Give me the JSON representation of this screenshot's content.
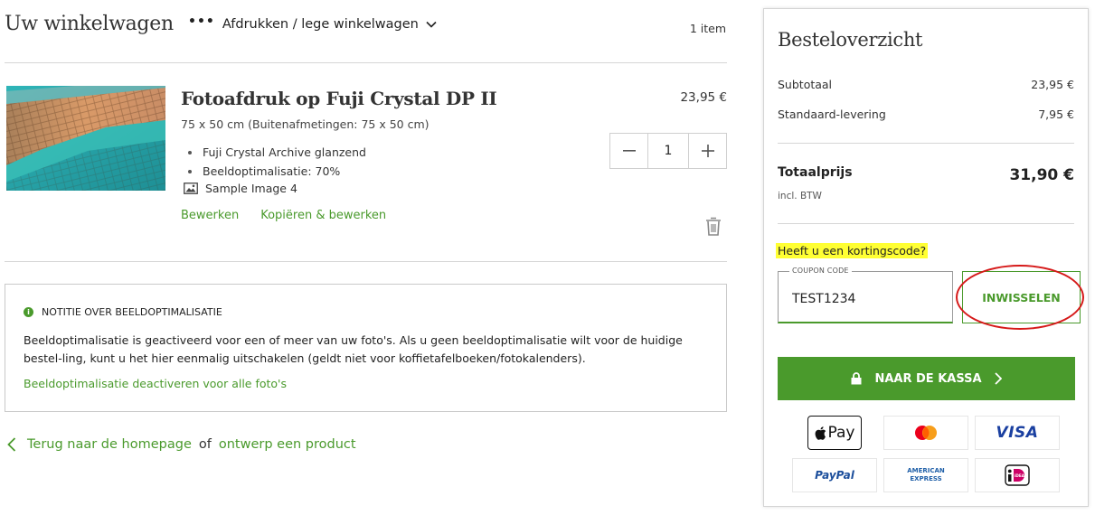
{
  "header": {
    "title": "Uw winkelwagen",
    "menu_label": "Afdrukken / lege winkelwagen",
    "item_count": "1 item"
  },
  "product": {
    "title": "Fotoafdruk op Fuji Crystal DP II",
    "size": "75 x 50 cm (Buitenafmetingen: 75 x 50 cm)",
    "options": [
      "Fuji Crystal Archive glanzend",
      "Beeldoptimalisatie: 70%"
    ],
    "image_name": "Sample Image 4",
    "edit_label": "Bewerken",
    "copy_edit_label": "Kopiëren & bewerken",
    "price": "23,95 €",
    "quantity": "1"
  },
  "notice": {
    "heading": "NOTITIE OVER BEELDOPTIMALISATIE",
    "text": "Beeldoptimalisatie is geactiveerd voor een of meer van uw foto's. Als u geen beeldoptimalisatie wilt voor de huidige bestel-ling, kunt u het hier eenmalig uitschakelen (geldt niet voor koffietafelboeken/fotokalenders).",
    "link": "Beeldoptimalisatie deactiveren voor alle foto's"
  },
  "footer_nav": {
    "back_link": "Terug naar de homepage",
    "separator": "of",
    "design_link": "ontwerp een product"
  },
  "summary": {
    "title": "Besteloverzicht",
    "subtotal_label": "Subtotaal",
    "subtotal_value": "23,95 €",
    "shipping_label": "Standaard-levering",
    "shipping_value": "7,95 €",
    "total_label": "Totaalprijs",
    "total_value": "31,90 €",
    "vat_note": "incl. BTW",
    "coupon_question": "Heeft u een kortingscode?",
    "coupon_label": "COUPON CODE",
    "coupon_value": "TEST1234",
    "redeem_label": "INWISSELEN",
    "checkout_label": "NAAR DE KASSA"
  },
  "payment_methods": [
    {
      "name": "Apple Pay",
      "label": "Pay"
    },
    {
      "name": "Mastercard",
      "label": ""
    },
    {
      "name": "Visa",
      "label": "VISA"
    },
    {
      "name": "PayPal",
      "label": "PayPal"
    },
    {
      "name": "American Express",
      "label": "AMERICAN EXPRESS"
    },
    {
      "name": "iDEAL",
      "label": "iDEAL"
    }
  ],
  "colors": {
    "accent_green": "#4a9a2c",
    "highlight_yellow": "#ffff33",
    "annotation_red": "#d61a1a"
  }
}
